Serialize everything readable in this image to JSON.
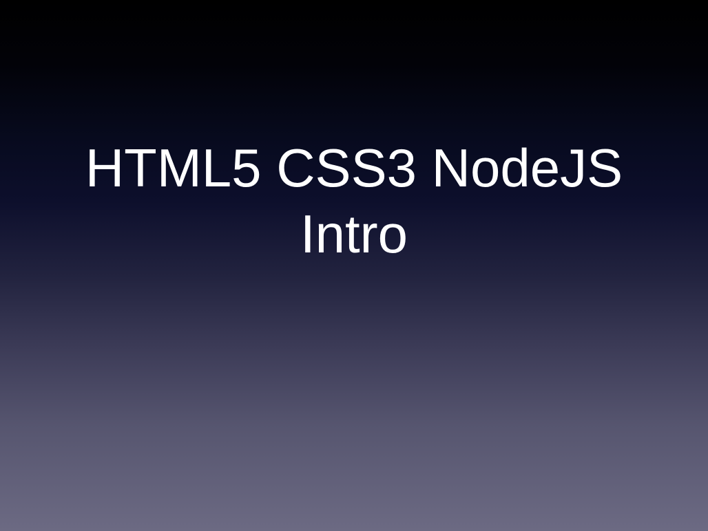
{
  "slide": {
    "title_lines": [
      "HTML5 CSS3 NodeJS",
      "Intro"
    ],
    "background_colors": {
      "top": "#000000",
      "middle": "#0d0f2c",
      "bottom": "#6c6a83"
    },
    "text_color": "#ffffff"
  }
}
